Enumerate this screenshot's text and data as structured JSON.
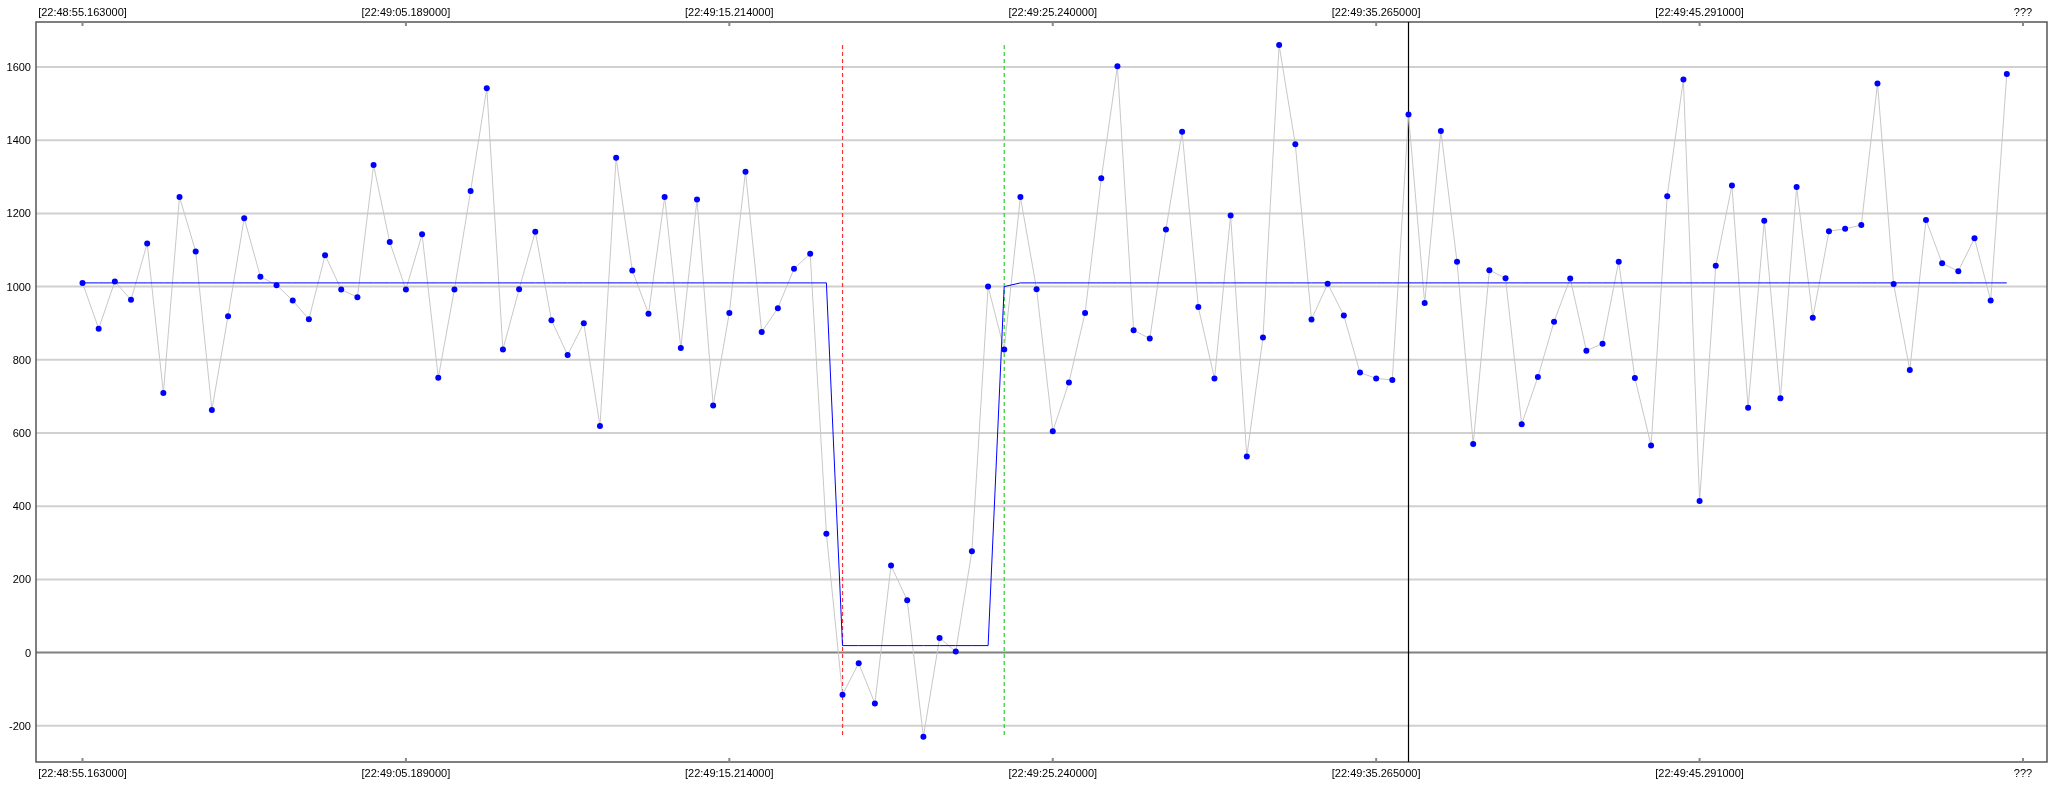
{
  "plot": {
    "top_axis": {
      "labels": [
        "[22:48:55.163000]",
        "[22:49:05.189000]",
        "[22:49:15.214000]",
        "[22:49:25.240000]",
        "[22:49:35.265000]",
        "[22:49:45.291000]",
        "???"
      ]
    },
    "chart_data": {
      "type": "line",
      "grid": true,
      "categories": [
        "[22:48:55.163000]",
        null,
        null,
        null,
        null,
        null,
        null,
        null,
        null,
        null,
        null,
        null,
        null,
        null,
        null,
        null,
        null,
        null,
        null,
        null,
        "[22:49:05.189000]",
        null,
        null,
        null,
        null,
        null,
        null,
        null,
        null,
        null,
        null,
        null,
        null,
        null,
        null,
        null,
        null,
        null,
        null,
        null,
        "[22:49:15.214000]",
        null,
        null,
        null,
        null,
        null,
        null,
        null,
        null,
        null,
        null,
        null,
        null,
        null,
        null,
        null,
        null,
        null,
        null,
        null,
        "[22:49:25.240000]",
        null,
        null,
        null,
        null,
        null,
        null,
        null,
        null,
        null,
        null,
        null,
        null,
        null,
        null,
        null,
        null,
        null,
        null,
        null,
        "[22:49:35.265000]",
        null,
        null,
        null,
        null,
        null,
        null,
        null,
        null,
        null,
        null,
        null,
        null,
        null,
        null,
        null,
        null,
        null,
        null,
        null,
        "[22:49:45.291000]",
        null,
        null,
        null,
        null,
        null,
        null,
        null,
        null,
        null,
        null,
        null,
        null,
        null,
        null,
        null,
        null,
        null,
        null,
        null,
        "???"
      ],
      "series": [
        {
          "color": "#0000ff",
          "marker": "circle",
          "values": [
            1010,
            885,
            1014,
            964,
            1118,
            709,
            1245,
            1096,
            663,
            919,
            1187,
            1027,
            1004,
            962,
            911,
            1086,
            992,
            971,
            1332,
            1122,
            992,
            1143,
            751,
            992,
            1261,
            1542,
            828,
            993,
            1150,
            908,
            813,
            900,
            619,
            1352,
            1044,
            926,
            1245,
            832,
            1238,
            675,
            928,
            1314,
            876,
            941,
            1049,
            1090,
            325,
            -115,
            -29,
            -139,
            238,
            143,
            -230,
            40,
            3,
            277,
            1000,
            828,
            1245,
            993,
            605,
            738,
            928,
            1296,
            1602,
            881,
            858,
            1156,
            1423,
            944,
            749,
            1194,
            536,
            861,
            1660,
            1389,
            910,
            1008,
            921,
            765,
            749,
            745,
            1470,
            955,
            1425,
            1068,
            570,
            1045,
            1023,
            624,
            753,
            904,
            1022,
            825,
            844,
            1068,
            750,
            566,
            1247,
            1566,
            414,
            1057,
            1276,
            669,
            1180,
            695,
            1272,
            915,
            1151,
            1158,
            1168,
            1555,
            1007,
            772,
            1182,
            1064,
            1042,
            1132,
            962,
            1581,
            null
          ]
        },
        {
          "color": "#0000ff",
          "values": [
            1010,
            1010,
            1010,
            1010,
            1010,
            1010,
            1010,
            1010,
            1010,
            1010,
            1010,
            1010,
            1010,
            1010,
            1010,
            1010,
            1010,
            1010,
            1010,
            1010,
            1010,
            1010,
            1010,
            1010,
            1010,
            1010,
            1010,
            1010,
            1010,
            1010,
            1010,
            1010,
            1010,
            1010,
            1010,
            1010,
            1010,
            1010,
            1010,
            1010,
            1010,
            1010,
            1010,
            1010,
            1010,
            1010,
            1010,
            19,
            19,
            19,
            19,
            19,
            19,
            19,
            19,
            19,
            19,
            1000,
            1010,
            1010,
            1010,
            1010,
            1010,
            1010,
            1010,
            1010,
            1010,
            1010,
            1010,
            1010,
            1010,
            1010,
            1010,
            1010,
            1010,
            1010,
            1010,
            1010,
            1010,
            1010,
            1010,
            1010,
            1010,
            1010,
            1010,
            1010,
            1010,
            1010,
            1010,
            1010,
            1010,
            1010,
            1010,
            1010,
            1010,
            1010,
            1010,
            1010,
            1010,
            1010,
            1010,
            1010,
            1010,
            1010,
            1010,
            1010,
            1010,
            1010,
            1010,
            1010,
            1010,
            1010,
            1010,
            1010,
            1010,
            1010,
            1010,
            1010,
            1010,
            1010,
            null
          ]
        }
      ],
      "ylim": [
        -299,
        1723
      ],
      "yticks": [
        -200,
        0,
        200,
        400,
        600,
        800,
        1000,
        1200,
        1400,
        1600
      ]
    }
  }
}
